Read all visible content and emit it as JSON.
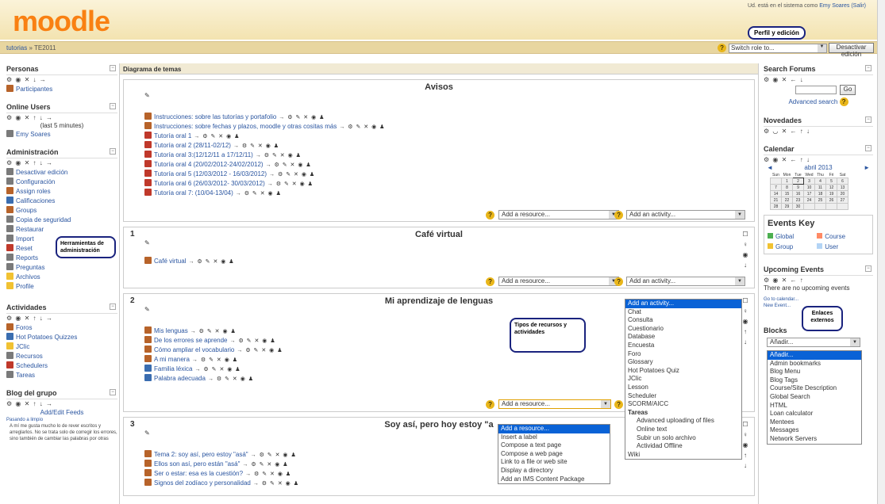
{
  "header": {
    "logo": "moodle",
    "login_text": "Ud. está en el sistema como",
    "user_link": "Emy Soares",
    "logout": "(Salir)",
    "profile_note": "Perfil y edición"
  },
  "nav": {
    "crumb_home": "tutorias",
    "crumb_sep": "»",
    "crumb_course": "TE2011",
    "switch_role": "Switch role to...",
    "edit_button": "Desactivar edición"
  },
  "left": {
    "personas": {
      "title": "Personas",
      "controls": "⚙ ◉ ✕ ↓ →",
      "items": [
        "Participantes"
      ]
    },
    "online": {
      "title": "Online Users",
      "controls": "⚙ ◉ ✕ ↑ ↓ →",
      "note": "(last 5 minutes)",
      "users": [
        "Emy Soares"
      ]
    },
    "admin": {
      "title": "Administración",
      "controls": "⚙ ◉ ✕ ↑ ↓ →",
      "items": [
        "Desactivar edición",
        "Configuración",
        "Assign roles",
        "Calificaciones",
        "Groups",
        "Copia de seguridad",
        "Restaurar",
        "Import",
        "Reset",
        "Reports",
        "Preguntas",
        "Archivos",
        "Profile"
      ],
      "note": "Herramientas de administración"
    },
    "actividades": {
      "title": "Actividades",
      "controls": "⚙ ◉ ✕ ↑ ↓ →",
      "items": [
        "Foros",
        "Hot Potatoes Quizzes",
        "JClic",
        "Recursos",
        "Schedulers",
        "Tareas"
      ]
    },
    "blog": {
      "title": "Blog del grupo",
      "controls": "⚙ ◉ ✕ ↑ ↓ →",
      "add": "Add/Edit Feeds",
      "source": "Pasando a limpio",
      "text": "A mí me gusta mucho lo de rever escritos y arreglarlos. No se trata solo de corregir los errores, sino también de cambiar las palabras por otras que me gustan más, más adecuadas... A través el"
    }
  },
  "main": {
    "heading": "Diagrama de temas",
    "avisos": {
      "title": "Avisos",
      "items": [
        "Instrucciones: sobre las tutorías y portafolio",
        "Instrucciones: sobre fechas y plazos, moodle y otras cositas más",
        "Tutoría oral 1",
        "Tutoría oral 2 (28/11-02/12)",
        "Tutoría oral 3:(12/12/11 a 17/12/11)",
        "Tutoría oral 4 (20/02/2012-24/02/2012)",
        "Tutoría oral 5 (12/03/2012 - 16/03/2012)",
        "Tutoría oral 6 (26/03/2012- 30/03/2012)",
        "Tutoría oral 7: (10/04-13/04)"
      ]
    },
    "s1": {
      "num": "1",
      "title": "Café virtual",
      "items": [
        "Café virtual"
      ]
    },
    "s2": {
      "num": "2",
      "title": "Mi aprendizaje de lenguas",
      "items": [
        "Mis lenguas",
        "De los errores se aprende",
        "Cómo ampliar el vocabulario",
        "A mi manera",
        "Familia léxica",
        "Palabra adecuada"
      ],
      "note": "Tipos de recursos y actividades"
    },
    "s3": {
      "num": "3",
      "title": "Soy así, pero hoy estoy \"a",
      "items": [
        "Tema 2: soy así, pero estoy \"asá\"",
        "Ellos son así, pero están \"asá\"",
        "Ser o estar: esa es la cuestión?",
        "Signos del zodíaco y personalidad"
      ]
    },
    "add_resource": "Add a resource...",
    "add_activity": "Add an activity...",
    "activity_options": [
      "Add an activity...",
      "Chat",
      "Consulta",
      "Cuestionario",
      "Database",
      "Encuesta",
      "Foro",
      "Glossary",
      "Hot Potatoes Quiz",
      "JClic",
      "Lesson",
      "Scheduler",
      "SCORM/AICC",
      "Tareas",
      "Advanced uploading of files",
      "Online text",
      "Subir un solo archivo",
      "Actividad Offline",
      "Wiki"
    ],
    "resource_options": [
      "Add a resource...",
      "Insert a label",
      "Compose a text page",
      "Compose a web page",
      "Link to a file or web site",
      "Display a directory",
      "Add an IMS Content Package"
    ],
    "edit_icons": "→ ⚙ ✎ ✕ ◉ ♟"
  },
  "right": {
    "search": {
      "title": "Search Forums",
      "controls": "⚙ ◉ ✕ ← ↓",
      "go": "Go",
      "advanced": "Advanced search"
    },
    "news": {
      "title": "Novedades",
      "controls": "⚙ ◡ ✕ ← ↑ ↓"
    },
    "calendar": {
      "title": "Calendar",
      "controls": "⚙ ◉ ✕ ← ↑ ↓",
      "month": "abril 2013",
      "days": [
        "Sun",
        "Mon",
        "Tue",
        "Wed",
        "Thu",
        "Fri",
        "Sat"
      ],
      "weeks": [
        [
          "",
          "1",
          "2",
          "3",
          "4",
          "5",
          "6"
        ],
        [
          "7",
          "8",
          "9",
          "10",
          "11",
          "12",
          "13"
        ],
        [
          "14",
          "15",
          "16",
          "17",
          "18",
          "19",
          "20"
        ],
        [
          "21",
          "22",
          "23",
          "24",
          "25",
          "26",
          "27"
        ],
        [
          "28",
          "29",
          "30",
          "",
          "",
          "",
          ""
        ]
      ]
    },
    "events": {
      "title": "Events Key",
      "global": "Global",
      "course": "Course",
      "group": "Group",
      "user": "User"
    },
    "upcoming": {
      "title": "Upcoming Events",
      "controls": "⚙ ◉ ✕ ← ↑",
      "none": "There are no upcoming events",
      "goto": "Go to calendar...",
      "new": "New Event..."
    },
    "blocks": {
      "title": "Blocks",
      "select": "Añadir...",
      "note": "Enlaces externos",
      "options": [
        "Añadir...",
        "Admin bookmarks",
        "Blog Menu",
        "Blog Tags",
        "Course/Site Description",
        "Global Search",
        "HTML",
        "Loan calculator",
        "Mentees",
        "Messages",
        "Network Servers"
      ]
    }
  },
  "colors": {
    "accent": "#f98012",
    "link": "#2a55a0",
    "highlight": "#0a62d6",
    "note_border": "#1a237e"
  }
}
